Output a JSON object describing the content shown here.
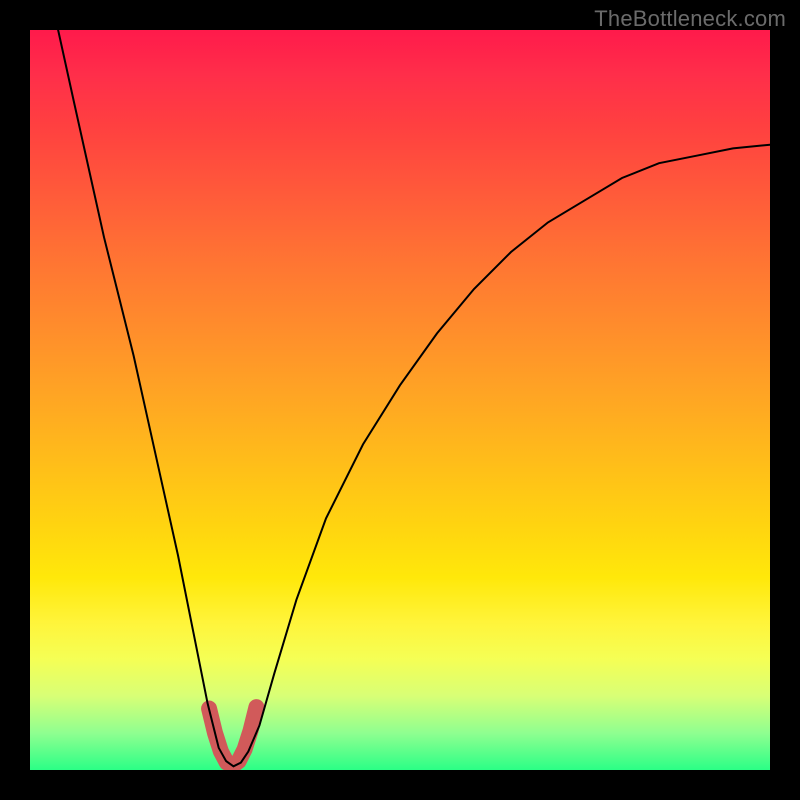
{
  "watermark": "TheBottleneck.com",
  "chart_data": {
    "type": "line",
    "title": "",
    "xlabel": "",
    "ylabel": "",
    "xlim": [
      0,
      1
    ],
    "ylim": [
      0,
      1
    ],
    "grid": false,
    "legend": null,
    "series": [
      {
        "name": "main-curve",
        "color": "#000000",
        "stroke_width": 2,
        "x": [
          0.038,
          0.06,
          0.08,
          0.1,
          0.12,
          0.14,
          0.16,
          0.18,
          0.2,
          0.22,
          0.24,
          0.255,
          0.265,
          0.275,
          0.285,
          0.295,
          0.31,
          0.33,
          0.36,
          0.4,
          0.45,
          0.5,
          0.55,
          0.6,
          0.65,
          0.7,
          0.75,
          0.8,
          0.85,
          0.9,
          0.95,
          1.0
        ],
        "y": [
          1.0,
          0.9,
          0.81,
          0.72,
          0.64,
          0.56,
          0.47,
          0.38,
          0.29,
          0.19,
          0.09,
          0.03,
          0.012,
          0.005,
          0.01,
          0.025,
          0.06,
          0.13,
          0.23,
          0.34,
          0.44,
          0.52,
          0.59,
          0.65,
          0.7,
          0.74,
          0.77,
          0.8,
          0.82,
          0.83,
          0.84,
          0.845
        ]
      },
      {
        "name": "highlight-curve",
        "color": "#d15a5a",
        "stroke_width": 16,
        "x": [
          0.242,
          0.25,
          0.258,
          0.266,
          0.274,
          0.282,
          0.29,
          0.298,
          0.306
        ],
        "y": [
          0.083,
          0.05,
          0.025,
          0.01,
          0.006,
          0.012,
          0.028,
          0.053,
          0.085
        ]
      }
    ]
  }
}
